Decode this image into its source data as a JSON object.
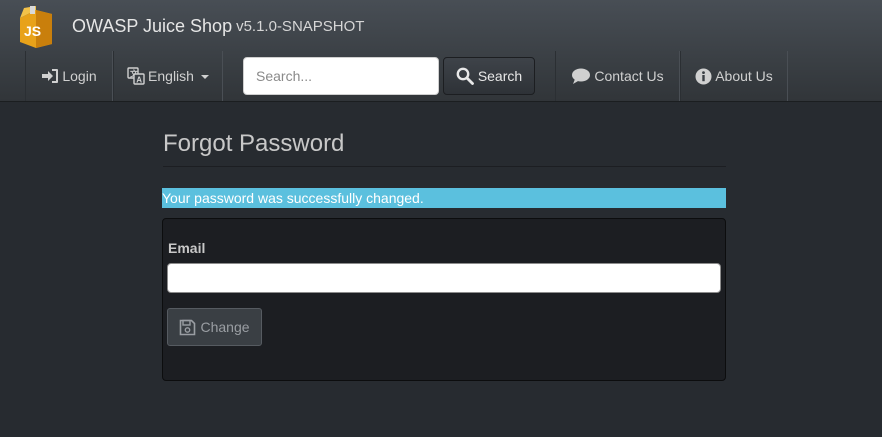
{
  "navbar": {
    "brand": {
      "logo_icon": "juice-carton-logo",
      "title": "OWASP Juice Shop",
      "version": "v5.1.0-SNAPSHOT"
    },
    "login_label": "Login",
    "language_label": "English",
    "search": {
      "placeholder": "Search...",
      "value": "",
      "button_label": "Search"
    },
    "contact_label": "Contact Us",
    "about_label": "About Us"
  },
  "main": {
    "title": "Forgot Password",
    "alert": {
      "message": "Your password was successfully changed.",
      "color": "#5bc0de"
    },
    "form": {
      "email_label": "Email",
      "email_value": "",
      "submit_label": "Change",
      "submit_enabled": false
    }
  },
  "colors": {
    "background": "#272b30",
    "navbar": "#3a3f44",
    "panel": "#1c1e22",
    "info": "#5bc0de"
  }
}
